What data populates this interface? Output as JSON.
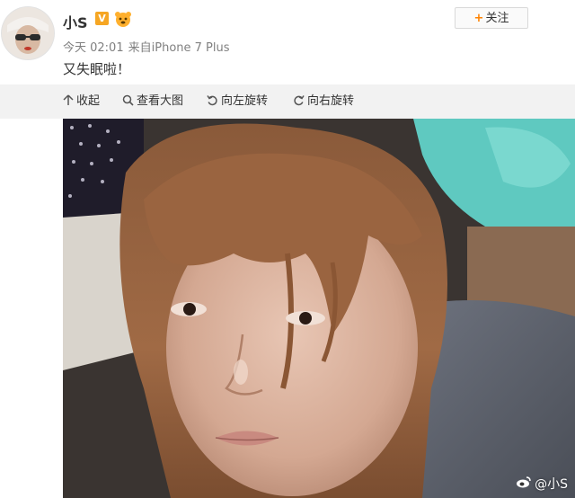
{
  "post": {
    "username": "小S",
    "verified_badge": "V",
    "timestamp": "今天 02:01",
    "source_prefix": "来自",
    "source_device": "iPhone 7 Plus",
    "text": "又失眠啦！"
  },
  "follow_button": {
    "label": "关注",
    "icon": "plus-icon"
  },
  "toolbar": {
    "collapse_label": "收起",
    "view_large_label": "查看大图",
    "rotate_left_label": "向左旋转",
    "rotate_right_label": "向右旋转"
  },
  "photo": {
    "watermark_text": "@小S"
  },
  "colors": {
    "accent_orange": "#ff8200",
    "badge_gold": "#f6a623",
    "toolbar_bg": "#f2f2f2",
    "meta_gray": "#808080"
  },
  "icons": [
    "avatar",
    "verified-badge-icon",
    "vip-icon",
    "plus-icon",
    "collapse-arrow-icon",
    "magnify-icon",
    "rotate-left-icon",
    "rotate-right-icon",
    "weibo-logo-icon"
  ]
}
